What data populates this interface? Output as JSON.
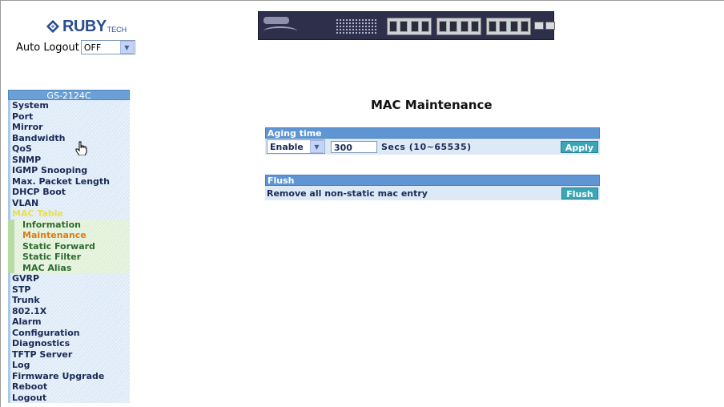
{
  "brand": {
    "name": "RUBY",
    "suffix": "TECH"
  },
  "auto_logout": {
    "label": "Auto Logout",
    "value": "OFF"
  },
  "sidebar": {
    "title": "GS-2124C",
    "items_top": [
      "System",
      "Port",
      "Mirror",
      "Bandwidth",
      "QoS",
      "SNMP",
      "IGMP Snooping",
      "Max. Packet Length",
      "DHCP Boot",
      "VLAN"
    ],
    "active_parent": "MAC Table",
    "sub_items": [
      "Information",
      "Maintenance",
      "Static Forward",
      "Static Filter",
      "MAC Alias"
    ],
    "active_sub": "Maintenance",
    "items_bottom": [
      "GVRP",
      "STP",
      "Trunk",
      "802.1X",
      "Alarm",
      "Configuration",
      "Diagnostics",
      "TFTP Server",
      "Log",
      "Firmware Upgrade",
      "Reboot",
      "Logout"
    ]
  },
  "main": {
    "title": "MAC Maintenance",
    "aging": {
      "header": "Aging time",
      "mode": "Enable",
      "value": "300",
      "unit_hint": "Secs  (10~65535)",
      "apply_label": "Apply"
    },
    "flush": {
      "header": "Flush",
      "description": "Remove all non-static mac entry",
      "button_label": "Flush"
    }
  }
}
